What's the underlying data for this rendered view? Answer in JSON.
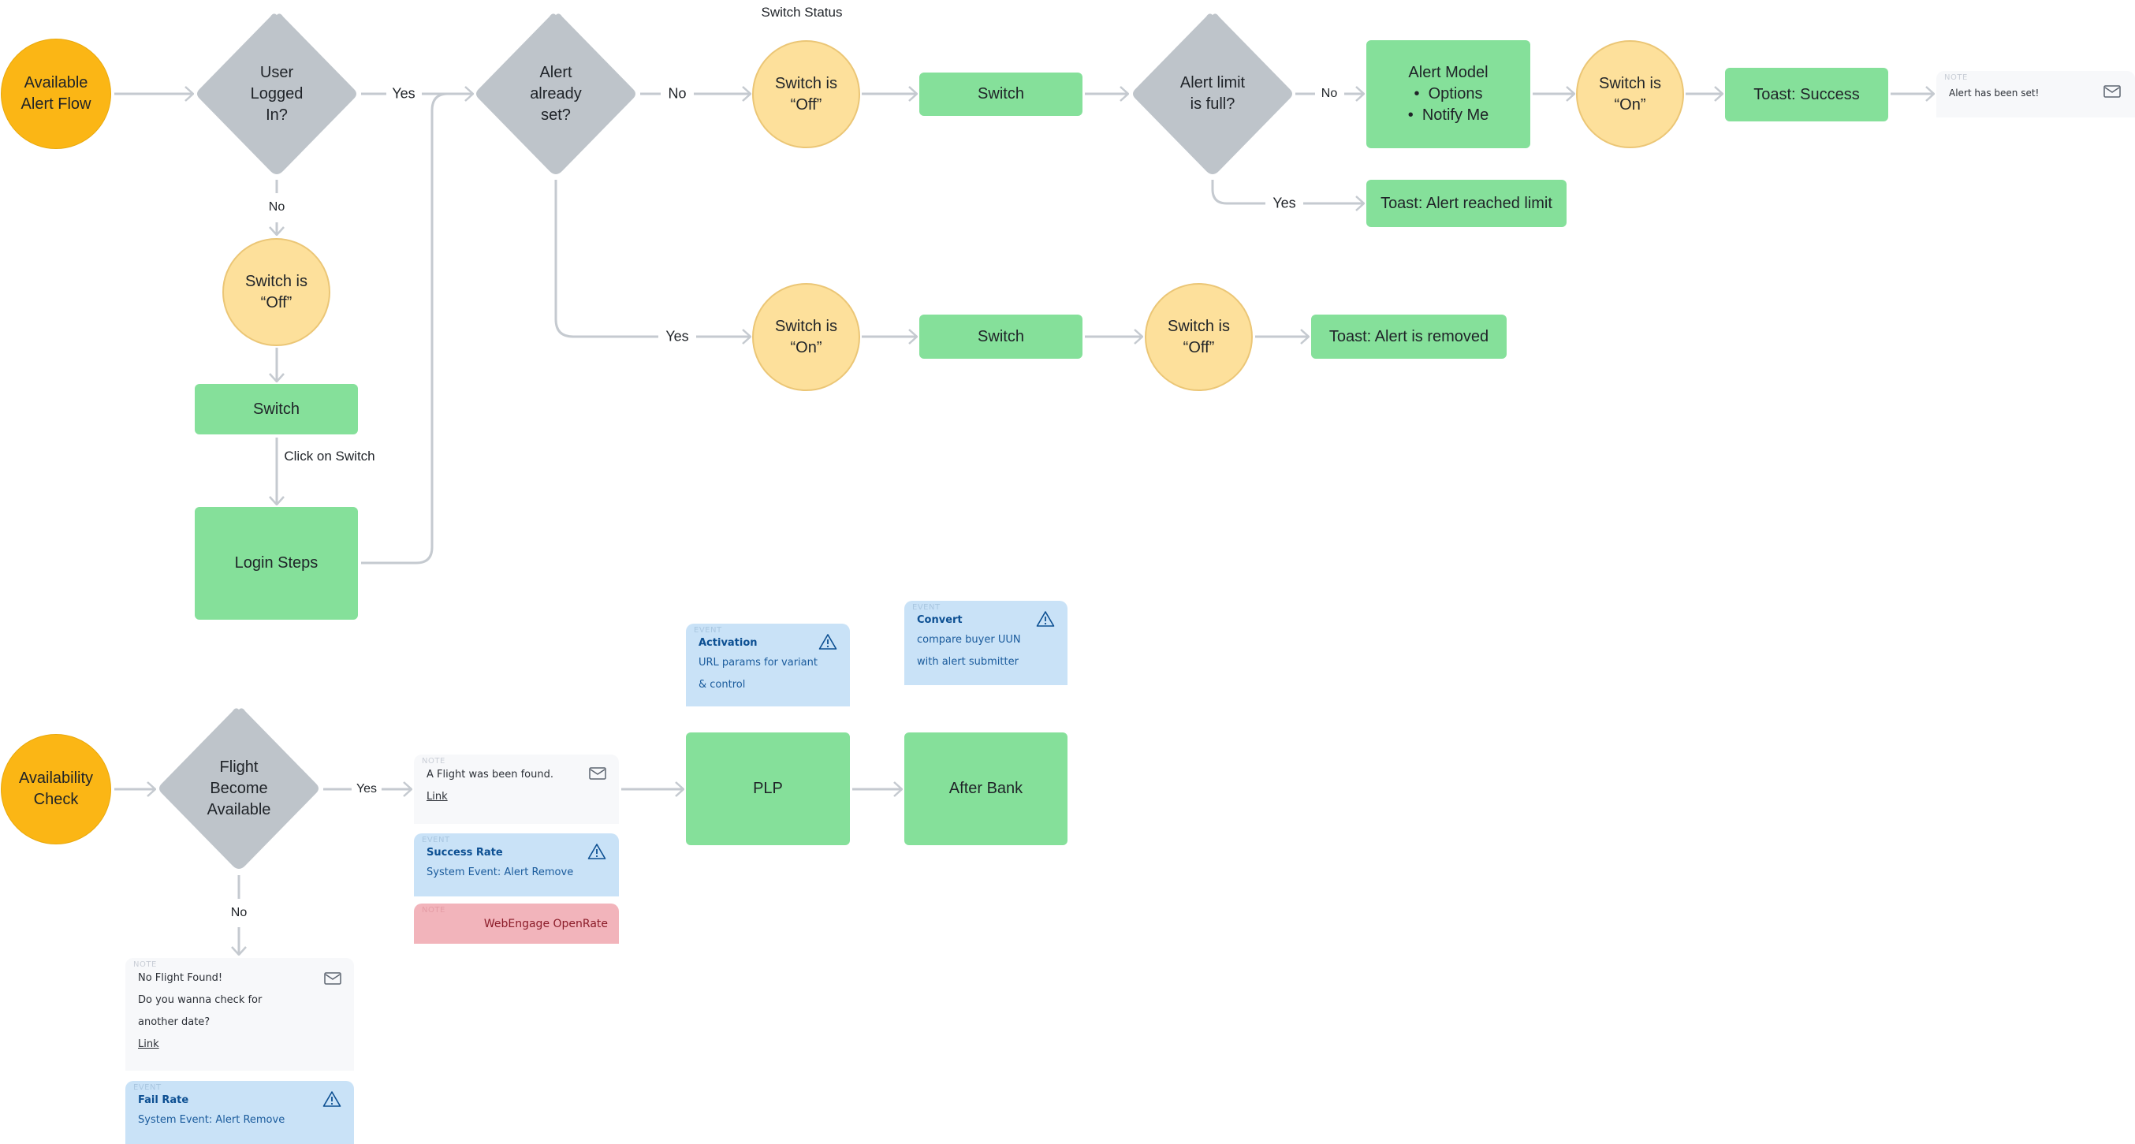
{
  "diagram": {
    "title_label": "Switch Status",
    "flow1": {
      "start": "Available Alert Flow",
      "decision_logged_in": "User Logged In?",
      "decision_alert_set": "Alert already set?",
      "state_off_1": "Switch is “Off”",
      "switch_1": "Switch",
      "decision_limit": "Alert limit is full?",
      "alert_model": {
        "title": "Alert Model",
        "items": [
          "Options",
          "Notify Me"
        ]
      },
      "state_on_1": "Switch is “On”",
      "toast_success": "Toast: Success",
      "toast_limit": "Toast: Alert reached limit",
      "note_set": {
        "kind": "NOTE",
        "text": "Alert has been set!",
        "icon": "envelope-icon"
      },
      "state_off_login": "Switch is “Off”",
      "switch_login": "Switch",
      "login_steps": "Login Steps",
      "state_on_2": "Switch is “On”",
      "switch_2": "Switch",
      "state_off_2": "Switch is “Off”",
      "toast_removed": "Toast: Alert is removed"
    },
    "edge_labels": {
      "yes": "Yes",
      "no": "No",
      "click_on_switch": "Click on Switch"
    },
    "flow2": {
      "start": "Availability Check",
      "decision_flight": "Flight Become Available",
      "note_found": {
        "kind": "NOTE",
        "text": "A Flight was been found.",
        "link": "Link",
        "icon": "envelope-icon"
      },
      "event_success": {
        "kind": "EVENT",
        "title": "Success Rate",
        "text": "System Event: Alert Remove",
        "icon": "warning-icon"
      },
      "note_openrate": {
        "kind": "NOTE",
        "text": "WebEngage OpenRate"
      },
      "event_activation": {
        "kind": "EVENT",
        "title": "Activation",
        "text": "URL params for variant & control",
        "icon": "warning-icon"
      },
      "event_convert": {
        "kind": "EVENT",
        "title": "Convert",
        "text": "compare buyer UUN with alert submitter",
        "icon": "warning-icon"
      },
      "plp": "PLP",
      "after_bank": "After Bank",
      "note_not_found": {
        "kind": "NOTE",
        "line1": "No Flight Found!",
        "line2": "Do you wanna check for another date?",
        "link": "Link",
        "icon": "envelope-icon"
      },
      "event_fail": {
        "kind": "EVENT",
        "title": "Fail Rate",
        "text": "System Event: Alert Remove",
        "icon": "warning-icon"
      }
    },
    "colors": {
      "start": "#fbb615",
      "state": "#fde09b",
      "process": "#85e09a",
      "decision": "#bec4ca",
      "connector": "#c5cad0",
      "event": "#c9e2f7",
      "note": "#f7f8fa",
      "note_red": "#f2b4bb"
    }
  }
}
